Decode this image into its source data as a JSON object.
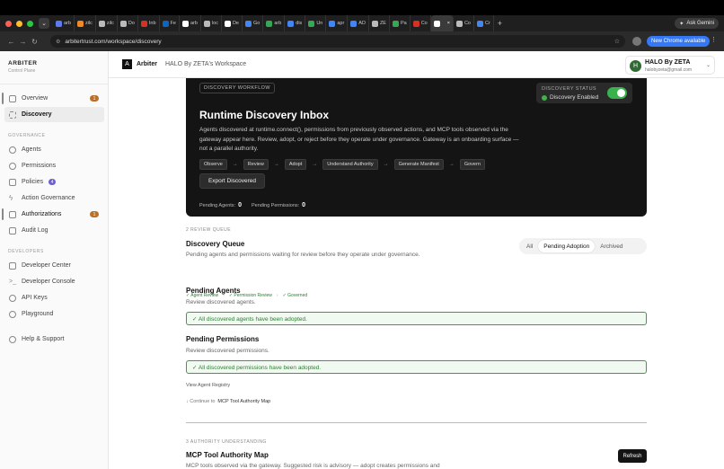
{
  "browser": {
    "tabs": [
      {
        "label": "arb",
        "color": "#5b7cf0"
      },
      {
        "label": "zilc",
        "color": "#f08a24"
      },
      {
        "label": "zilc",
        "color": "#bbbbbb"
      },
      {
        "label": "Do",
        "color": "#bbbbbb"
      },
      {
        "label": "Inb",
        "color": "#d93025"
      },
      {
        "label": "Fe",
        "color": "#0a66c2"
      },
      {
        "label": "arb",
        "color": "#ffffff"
      },
      {
        "label": "loc",
        "color": "#bbbbbb"
      },
      {
        "label": "De",
        "color": "#ffffff"
      },
      {
        "label": "Go",
        "color": "#4285f4"
      },
      {
        "label": "arb",
        "color": "#34a853"
      },
      {
        "label": "dis",
        "color": "#4285f4"
      },
      {
        "label": "Un",
        "color": "#34a853"
      },
      {
        "label": "apr",
        "color": "#4285f4"
      },
      {
        "label": "AD",
        "color": "#4285f4"
      },
      {
        "label": "ZE",
        "color": "#bbbbbb"
      },
      {
        "label": "Pa",
        "color": "#34a853"
      },
      {
        "label": "Co",
        "color": "#d93025"
      },
      {
        "label": "",
        "color": "#ffffff",
        "active": true
      },
      {
        "label": "Co",
        "color": "#bbbbbb"
      },
      {
        "label": "Cr",
        "color": "#4285f4"
      }
    ],
    "new_tab": "+",
    "gemini": "Ask Gemini",
    "url": "arbitertrust.com/workspace/discovery",
    "update_label": "New Chrome available"
  },
  "sidebar": {
    "brand": "ARBITER",
    "brand_sub": "Control Plane",
    "top_items": [
      {
        "label": "Overview",
        "badge": "1"
      },
      {
        "label": "Discovery"
      }
    ],
    "governance_label": "GOVERNANCE",
    "governance_items": [
      {
        "label": "Agents"
      },
      {
        "label": "Permissions"
      },
      {
        "label": "Policies",
        "badge": "4"
      },
      {
        "label": "Action Governance"
      },
      {
        "label": "Authorizations",
        "badge": "1"
      },
      {
        "label": "Audit Log"
      }
    ],
    "developers_label": "DEVELOPERS",
    "developer_items": [
      {
        "label": "Developer Center"
      },
      {
        "label": "Developer Console"
      },
      {
        "label": "API Keys"
      },
      {
        "label": "Playground"
      }
    ],
    "help": "Help & Support"
  },
  "topbar": {
    "logo": "A",
    "title": "Arbiter",
    "workspace": "HALO By ZETA's Workspace",
    "user_initial": "H",
    "user_name": "HALO By ZETA",
    "user_email": "halobyzeta@gmail.com"
  },
  "hero": {
    "tag": "DISCOVERY WORKFLOW",
    "status_label": "DISCOVERY STATUS",
    "status_value": "Discovery Enabled",
    "title": "Runtime Discovery Inbox",
    "description": "Agents discovered at runtime.connect(), permissions from previously observed actions, and MCP tools observed via the gateway appear here. Review, adopt, or reject before they operate under governance. Gateway is an onboarding surface — not a parallel authority.",
    "flow": [
      "Observe",
      "Review",
      "Adopt",
      "Understand Authority",
      "Generate Manifest",
      "Govern"
    ],
    "arrow": "→",
    "export_label": "Export Discovered",
    "pending_agents_label": "Pending Agents:",
    "pending_agents": "0",
    "pending_permissions_label": "Pending Permissions:",
    "pending_permissions": "0"
  },
  "queue": {
    "section_label": "2  REVIEW QUEUE",
    "title": "Discovery Queue",
    "description": "Pending agents and permissions waiting for review before they operate under governance.",
    "filters": [
      "All",
      "Pending Adoption",
      "Archived"
    ],
    "active_filter": "Pending Adoption",
    "steps": [
      "✓ Agent Review",
      "›",
      "✓ Permission Review",
      "›",
      "✓ Governed"
    ],
    "agents_title": "Pending Agents",
    "agents_desc": "Review discovered agents.",
    "agents_alert": "✓  All discovered agents have been adopted.",
    "perms_title": "Pending Permissions",
    "perms_desc": "Review discovered permissions.",
    "perms_alert": "✓  All discovered permissions have been adopted.",
    "registry_link": "View Agent Registry",
    "continue_prefix": "↓  Continue to",
    "continue_target": "MCP Tool Authority Map"
  },
  "authority": {
    "section_label": "3  AUTHORITY UNDERSTANDING",
    "title": "MCP Tool Authority Map",
    "description": "MCP tools observed via the gateway. Suggested risk is advisory — adopt creates permissions and",
    "refresh": "Refresh"
  }
}
